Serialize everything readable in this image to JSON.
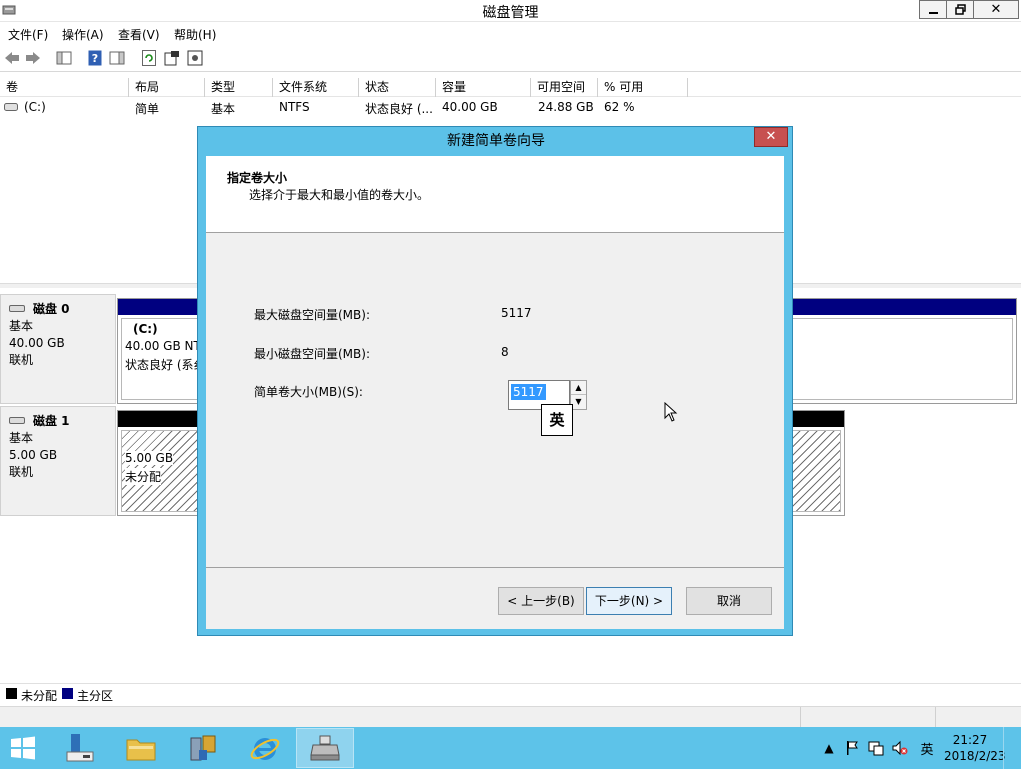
{
  "window": {
    "title": "磁盘管理"
  },
  "menu": {
    "file": "文件(F)",
    "action": "操作(A)",
    "view": "查看(V)",
    "help": "帮助(H)"
  },
  "volume_list": {
    "columns": [
      "卷",
      "布局",
      "类型",
      "文件系统",
      "状态",
      "容量",
      "可用空间",
      "% 可用"
    ],
    "rows": [
      {
        "volume": "(C:)",
        "layout": "简单",
        "type": "基本",
        "fs": "NTFS",
        "status": "状态良好 (...",
        "capacity": "40.00 GB",
        "free": "24.88 GB",
        "pct_free": "62 %"
      }
    ]
  },
  "disks": [
    {
      "name": "磁盘 0",
      "kind": "基本",
      "size": "40.00 GB",
      "state": "联机",
      "partition": {
        "label": "(C:)",
        "line1": "40.00 GB NT",
        "line2": "状态良好 (系纟"
      }
    },
    {
      "name": "磁盘 1",
      "kind": "基本",
      "size": "5.00 GB",
      "state": "联机",
      "partition": {
        "line1": "5.00 GB",
        "line2": "未分配"
      }
    }
  ],
  "legend": {
    "unallocated": "未分配",
    "primary": "主分区",
    "unallocated_color": "#000000",
    "primary_color": "#000080"
  },
  "dialog": {
    "title": "新建简单卷向导",
    "heading": "指定卷大小",
    "subheading": "选择介于最大和最小值的卷大小。",
    "max_label": "最大磁盘空间量(MB):",
    "max_value": "5117",
    "min_label": "最小磁盘空间量(MB):",
    "min_value": "8",
    "size_label": "简单卷大小(MB)(S):",
    "size_value": "5117",
    "ime_char": "英",
    "back_label": "< 上一步(B)",
    "next_label": "下一步(N) >",
    "cancel_label": "取消"
  },
  "tray": {
    "ime": "英",
    "time": "21:27",
    "date": "2018/2/23"
  },
  "colors": {
    "accent": "#5cc1e8",
    "taskbar": "#5dc3e9",
    "dialog_close": "#c75050",
    "selection": "#3399ff"
  }
}
